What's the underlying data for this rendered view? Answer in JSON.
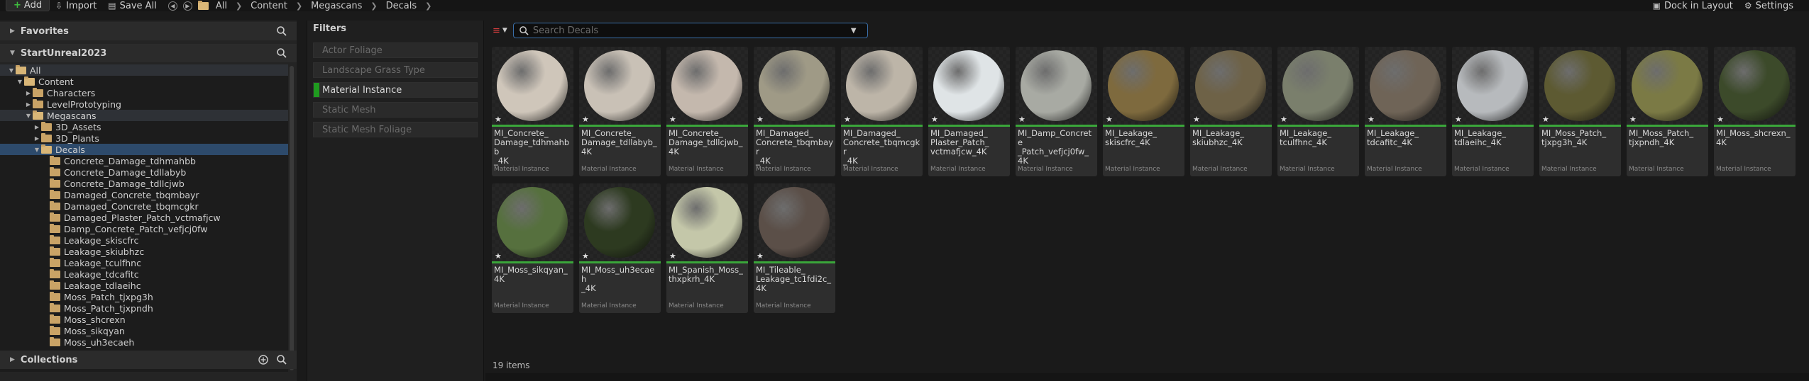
{
  "toolbar": {
    "add": "Add",
    "import": "Import",
    "save_all": "Save All",
    "breadcrumbs": [
      "All",
      "Content",
      "Megascans",
      "Decals"
    ],
    "dock": "Dock in Layout",
    "settings": "Settings"
  },
  "sidebar": {
    "favorites": "Favorites",
    "project": "StartUnreal2023",
    "collections": "Collections",
    "tree": [
      {
        "label": "All",
        "level": 0,
        "expanded": true
      },
      {
        "label": "Content",
        "level": 1,
        "expanded": true
      },
      {
        "label": "Characters",
        "level": 2,
        "expanded": false
      },
      {
        "label": "LevelPrototyping",
        "level": 2,
        "expanded": false
      },
      {
        "label": "Megascans",
        "level": 2,
        "expanded": true
      },
      {
        "label": "3D_Assets",
        "level": 3,
        "expanded": false
      },
      {
        "label": "3D_Plants",
        "level": 3,
        "expanded": false
      },
      {
        "label": "Decals",
        "level": 3,
        "expanded": true,
        "selected": true
      },
      {
        "label": "Concrete_Damage_tdhmahbb",
        "level": 4
      },
      {
        "label": "Concrete_Damage_tdllabyb",
        "level": 4
      },
      {
        "label": "Concrete_Damage_tdllcjwb",
        "level": 4
      },
      {
        "label": "Damaged_Concrete_tbqmbayr",
        "level": 4
      },
      {
        "label": "Damaged_Concrete_tbqmcgkr",
        "level": 4
      },
      {
        "label": "Damaged_Plaster_Patch_vctmafjcw",
        "level": 4
      },
      {
        "label": "Damp_Concrete_Patch_vefjcj0fw",
        "level": 4
      },
      {
        "label": "Leakage_skiscfrc",
        "level": 4
      },
      {
        "label": "Leakage_skiubhzc",
        "level": 4
      },
      {
        "label": "Leakage_tculfhnc",
        "level": 4
      },
      {
        "label": "Leakage_tdcafitc",
        "level": 4
      },
      {
        "label": "Leakage_tdlaeihc",
        "level": 4
      },
      {
        "label": "Moss_Patch_tjxpg3h",
        "level": 4
      },
      {
        "label": "Moss_Patch_tjxpndh",
        "level": 4
      },
      {
        "label": "Moss_shcrexn",
        "level": 4
      },
      {
        "label": "Moss_sikqyan",
        "level": 4
      },
      {
        "label": "Moss_uh3ecaeh",
        "level": 4
      }
    ]
  },
  "filters": {
    "title": "Filters",
    "items": [
      {
        "label": "Actor Foliage",
        "active": false
      },
      {
        "label": "Landscape Grass Type",
        "active": false
      },
      {
        "label": "Material Instance",
        "active": true
      },
      {
        "label": "Static Mesh",
        "active": false
      },
      {
        "label": "Static Mesh Foliage",
        "active": false
      }
    ]
  },
  "search": {
    "placeholder": "Search Decals",
    "value": ""
  },
  "assets": [
    {
      "name": "MI_Concrete_\nDamage_tdhmahbb\n_4K",
      "type": "Material Instance",
      "color": "#cfc6ba"
    },
    {
      "name": "MI_Concrete_\nDamage_tdllabyb_\n4K",
      "type": "Material Instance",
      "color": "#c9c1b6"
    },
    {
      "name": "MI_Concrete_\nDamage_tdllcjwb_\n4K",
      "type": "Material Instance",
      "color": "#c4b8ad"
    },
    {
      "name": "MI_Damaged_\nConcrete_tbqmbayr\n_4K",
      "type": "Material Instance",
      "color": "#9f9a86"
    },
    {
      "name": "MI_Damaged_\nConcrete_tbqmcgkr\n_4K",
      "type": "Material Instance",
      "color": "#bdb5a8"
    },
    {
      "name": "MI_Damaged_\nPlaster_Patch_\nvctmafjcw_4K",
      "type": "Material Instance",
      "color": "#dfe4e6"
    },
    {
      "name": "MI_Damp_Concrete\n_Patch_vefjcj0fw_\n4K",
      "type": "Material Instance",
      "color": "#a8aaa3"
    },
    {
      "name": "MI_Leakage_\nskiscfrc_4K",
      "type": "Material Instance",
      "color": "#7e6a3e"
    },
    {
      "name": "MI_Leakage_\nskiubhzc_4K",
      "type": "Material Instance",
      "color": "#6e6247"
    },
    {
      "name": "MI_Leakage_\ntculfhnc_4K",
      "type": "Material Instance",
      "color": "#7a7f6c"
    },
    {
      "name": "MI_Leakage_\ntdcafitc_4K",
      "type": "Material Instance",
      "color": "#6f6457"
    },
    {
      "name": "MI_Leakage_\ntdlaeihc_4K",
      "type": "Material Instance",
      "color": "#b7babd"
    },
    {
      "name": "MI_Moss_Patch_\ntjxpg3h_4K",
      "type": "Material Instance",
      "color": "#5d5a32"
    },
    {
      "name": "MI_Moss_Patch_\ntjxpndh_4K",
      "type": "Material Instance",
      "color": "#7b7a45"
    },
    {
      "name": "MI_Moss_shcrexn_\n4K",
      "type": "Material Instance",
      "color": "#3c4a2a"
    },
    {
      "name": "MI_Moss_sikqyan_\n4K",
      "type": "Material Instance",
      "color": "#56703e"
    },
    {
      "name": "MI_Moss_uh3ecaeh\n_4K",
      "type": "Material Instance",
      "color": "#2d3a20"
    },
    {
      "name": "MI_Spanish_Moss_\nthxpkrh_4K",
      "type": "Material Instance",
      "color": "#c4c7a9"
    },
    {
      "name": "MI_Tileable_\nLeakage_tc1fdi2c_\n4K",
      "type": "Material Instance",
      "color": "#5b4f48"
    }
  ],
  "status": {
    "count": "19 items"
  }
}
